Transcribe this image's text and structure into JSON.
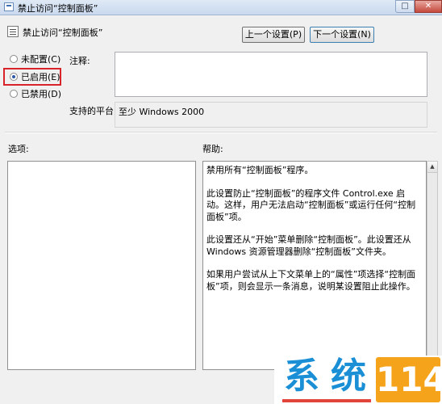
{
  "window": {
    "title": "禁止访问“控制面板”",
    "max_glyph": "□",
    "close_glyph": "✕"
  },
  "header": {
    "title": "禁止访问“控制面板”"
  },
  "nav": {
    "prev_label": "上一个设置(P)",
    "next_label": "下一个设置(N)"
  },
  "state": {
    "not_configured": "未配置(C)",
    "enabled": "已启用(E)",
    "disabled": "已禁用(D)",
    "selected": "enabled"
  },
  "comment": {
    "label": "注释:",
    "value": ""
  },
  "platform": {
    "label": "支持的平台:",
    "value": "至少 Windows 2000"
  },
  "options": {
    "label": "选项:"
  },
  "help": {
    "label": "帮助:",
    "paragraphs": [
      "禁用所有“控制面板”程序。",
      "此设置防止“控制面板”的程序文件 Control.exe 启动。这样，用户无法启动“控制面板”或运行任何“控制面板”项。",
      "此设置还从“开始”菜单删除“控制面板”。此设置还从 Windows 资源管理器删除“控制面板”文件夹。",
      "如果用户尝试从上下文菜单上的“属性”项选择“控制面板”项，则会显示一条消息，说明某设置阻止此操作。"
    ]
  },
  "watermark": {
    "char1": "系",
    "char2": "统",
    "number": "114"
  },
  "colors": {
    "highlight": "#d8232a",
    "watermark_blue": "#1a8fd6",
    "watermark_orange": "#f5a31a"
  }
}
